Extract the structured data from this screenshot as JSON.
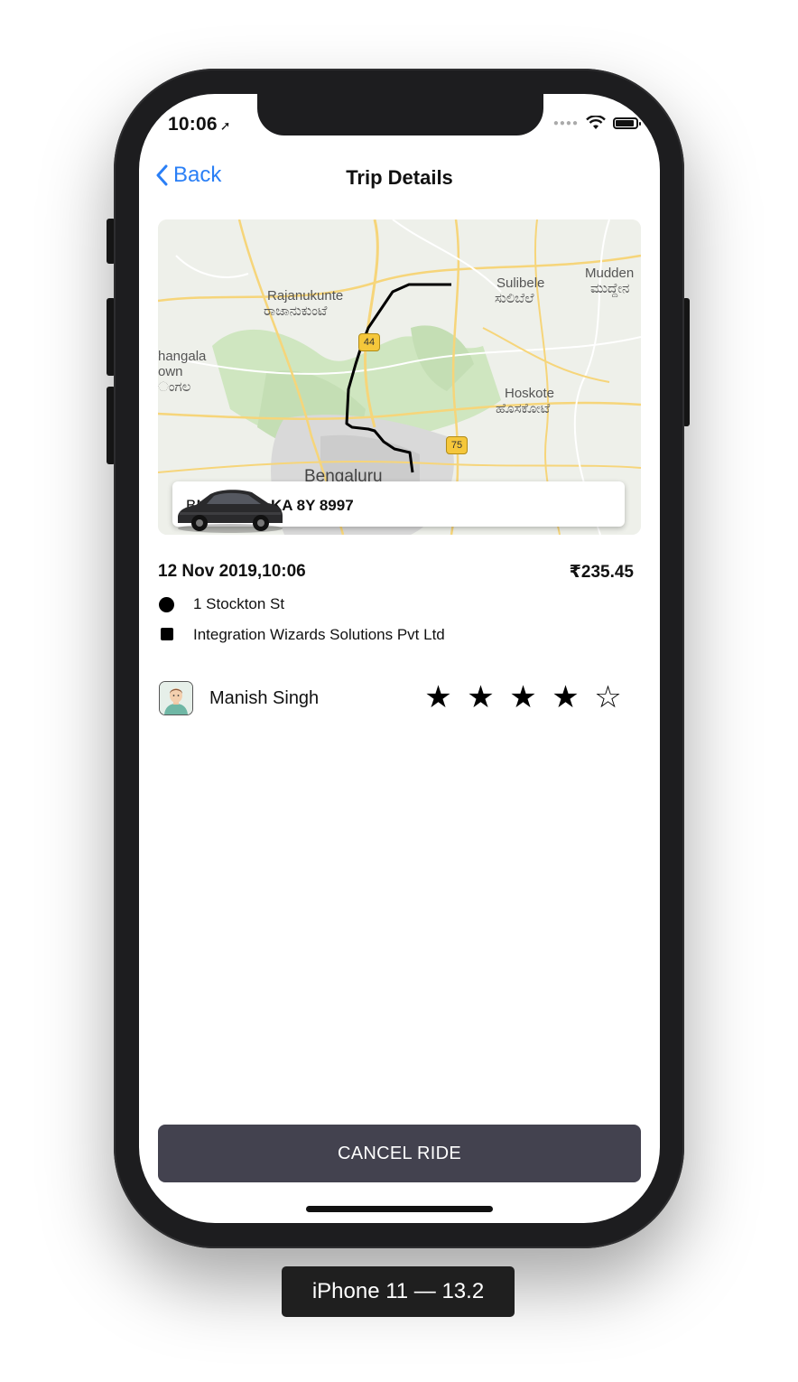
{
  "status_bar": {
    "time": "10:06",
    "location_icon": "location-arrow-icon"
  },
  "nav": {
    "back_label": "Back",
    "title": "Trip Details"
  },
  "map": {
    "labels": {
      "rajanukunte": "Rajanukunte",
      "rajanukunte_kn": "ರಾಜಾನುಕುಂಟೆ",
      "sulibele": "Sulibele",
      "sulibele_kn": "ಸುಲಿಬೆಲೆ",
      "mudden": "Mudden",
      "mudden_kn": "ಮುದ್ದೇನ",
      "hangala": "hangala",
      "own": "own",
      "ongala_kn": "ಂಗಲ",
      "hoskote": "Hoskote",
      "hoskote_kn": "ಹೊಸಕೋಟೆ",
      "bengaluru": "Bengaluru"
    },
    "highway_shields": [
      "44",
      "75"
    ]
  },
  "vehicle": {
    "model": "BMW X1S",
    "plate": "KA 8Y 8997"
  },
  "trip": {
    "date_time": "12 Nov 2019,10:06",
    "fare": "₹235.45",
    "pickup": "1 Stockton St",
    "dropoff": "Integration Wizards Solutions Pvt Ltd"
  },
  "driver": {
    "name": "Manish Singh",
    "rating": 4,
    "rating_max": 5
  },
  "actions": {
    "cancel_label": "CANCEL RIDE"
  },
  "device_label": "iPhone 11 — 13.2",
  "colors": {
    "accent": "#2a7ff6",
    "button_bg": "#43424f",
    "route": "#000000"
  }
}
